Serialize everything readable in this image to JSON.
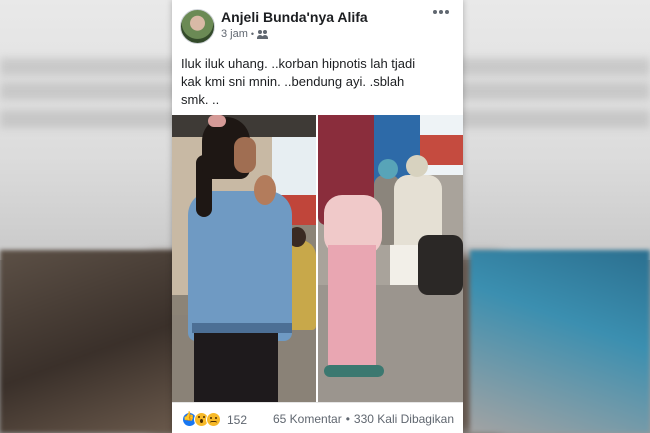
{
  "post": {
    "author": "Anjeli Bunda'nya Alifa",
    "time": "3 jam",
    "separator": "•",
    "audience_icon": "friends-icon",
    "text": "Iluk iluk uhang.   ..korban hipnotis lah tjadi\nkak kmi sni mnin.  ..bendung ayi.  .sblah\nsmk.  ..",
    "more_icon": "more-horizontal-icon"
  },
  "footer": {
    "reaction_icons": [
      "like-icon",
      "wow-icon",
      "sad-icon"
    ],
    "reaction_count": "152",
    "comments": "65 Komentar",
    "stat_separator": "•",
    "shares": "330 Kali Dibagikan"
  },
  "colors": {
    "card_background": "#ffffff",
    "text_primary": "#1c1e21",
    "text_secondary": "#606770",
    "like_blue": "#1877f2",
    "reaction_yellow": "#f7b928"
  }
}
